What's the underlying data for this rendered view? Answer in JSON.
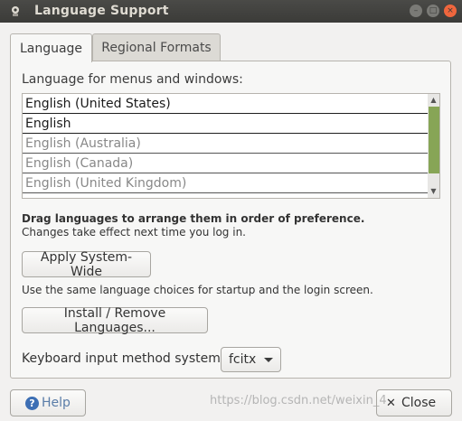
{
  "window": {
    "title": "Language Support",
    "controls": {
      "minimize": "–",
      "maximize": "□",
      "close": "×"
    }
  },
  "tabs": [
    {
      "label": "Language",
      "selected": true
    },
    {
      "label": "Regional Formats",
      "selected": false
    }
  ],
  "language_tab": {
    "menus_label": "Language for menus and windows:",
    "languages": [
      "English (United States)",
      "English",
      "English (Australia)",
      "English (Canada)",
      "English (United Kingdom)"
    ],
    "drag_hint": "Drag languages to arrange them in order of preference.",
    "changes_note": "Changes take effect next time you log in.",
    "apply_button": "Apply System-Wide",
    "same_note": "Use the same language choices for startup and the login screen.",
    "install_button": "Install / Remove Languages...",
    "keyboard_label": "Keyboard input method system:",
    "keyboard_value": "fcitx"
  },
  "footer": {
    "help_button": "Help",
    "close_button": "Close",
    "watermark": "https://blog.csdn.net/weixin_4"
  },
  "colors": {
    "titlebar": "#3b3b38",
    "close_control": "#f0663d",
    "scrollbar_thumb": "#87a556",
    "help_icon": "#3d6fb4"
  },
  "icons": {
    "app": "app-icon",
    "help": "help-icon",
    "close": "close-icon",
    "dropdown": "chevron-down-icon"
  }
}
